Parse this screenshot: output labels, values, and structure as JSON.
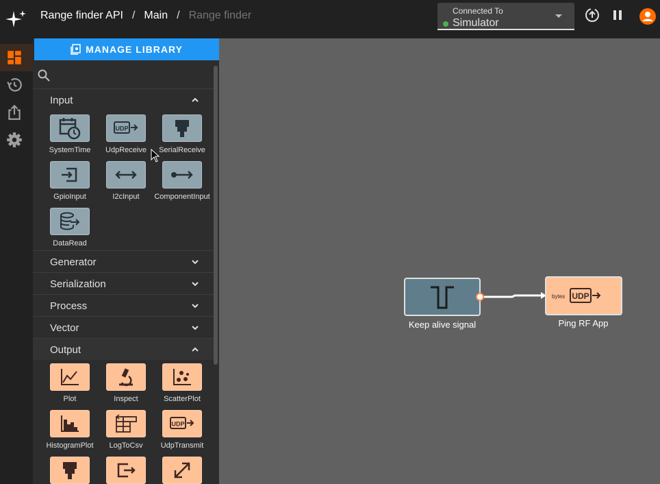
{
  "breadcrumb": [
    "Range finder API",
    "Main",
    "Range finder"
  ],
  "connection": {
    "label": "Connected To",
    "value": "Simulator"
  },
  "library": {
    "manage_label": "MANAGE LIBRARY"
  },
  "sections": {
    "input": "Input",
    "generator": "Generator",
    "serialization": "Serialization",
    "process": "Process",
    "vector": "Vector",
    "output": "Output"
  },
  "input_tools": [
    "SystemTime",
    "UdpReceive",
    "SerialReceive",
    "GpioInput",
    "I2cInput",
    "ComponentInput",
    "DataRead"
  ],
  "output_tools": [
    "Plot",
    "Inspect",
    "ScatterPlot",
    "HistogramPlot",
    "LogToCsv",
    "UdpTransmit"
  ],
  "nodes": {
    "keepalive": "Keep alive signal",
    "ping": "Ping RF App",
    "ping_bytes": "bytes",
    "ping_udp": "UDP"
  },
  "colors": {
    "accent": "#2196f3",
    "input_tile": "#90a4ae",
    "output_tile": "#ffc196",
    "status": "#4caf50",
    "user": "#ff6d00"
  }
}
